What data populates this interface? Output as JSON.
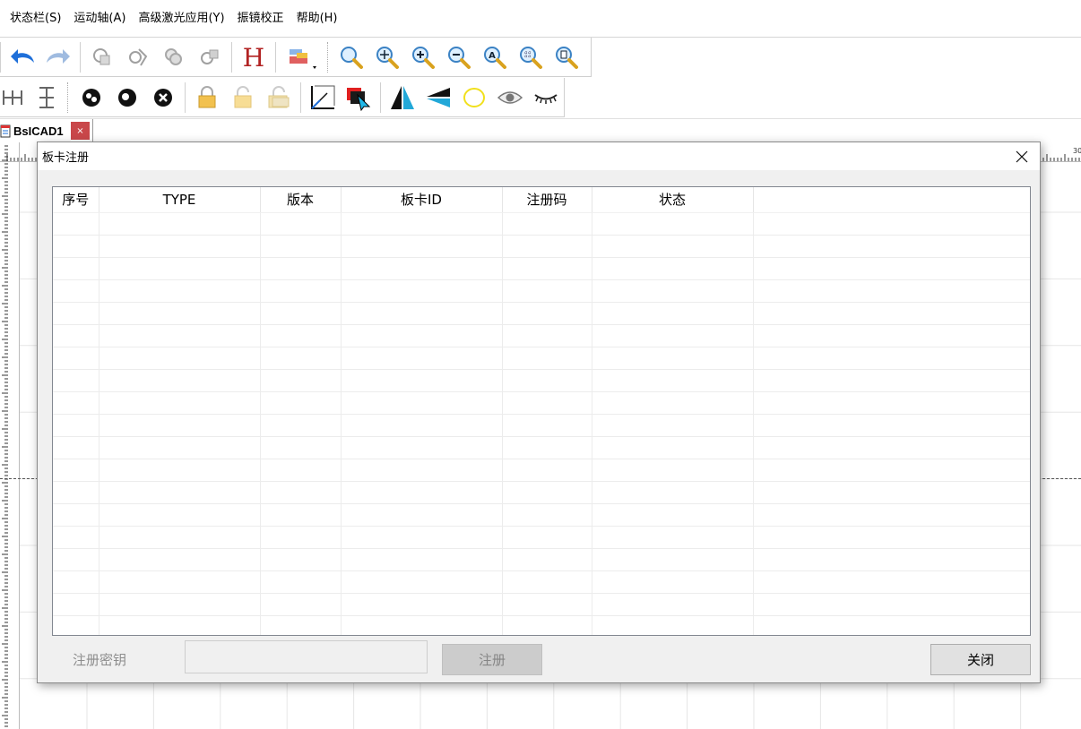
{
  "menu": [
    "状态栏(S)",
    "运动轴(A)",
    "高级激光应用(Y)",
    "振镜校正",
    "帮助(H)"
  ],
  "toolbar1": {
    "icons": [
      "undo-icon",
      "redo-icon",
      "copy-object-icon",
      "edit-object-icon",
      "duplicate-icon",
      "transform-object-icon",
      "hatch-h-icon",
      "fill-dropdown-icon",
      "zoom-icon",
      "zoom-pan-icon",
      "zoom-in-icon",
      "zoom-out-icon",
      "zoom-all-icon",
      "zoom-grid-icon",
      "zoom-page-icon"
    ]
  },
  "toolbar2": {
    "icons": [
      "distribute-horizontal-icon",
      "distribute-vertical-icon",
      "group-icon",
      "ungroup-icon",
      "delete-group-icon",
      "lock-icon",
      "unlock-icon",
      "unlock-all-icon",
      "axis-origin-icon",
      "color-layer-icon",
      "mirror-horizontal-icon",
      "mirror-vertical-icon",
      "ellipse-icon",
      "show-icon",
      "hide-icon"
    ]
  },
  "doc_tab": {
    "label": "BsICAD1",
    "close": "×"
  },
  "canvas": {
    "ruler_label": "30"
  },
  "dialog": {
    "title": "板卡注册",
    "columns": [
      "序号",
      "TYPE",
      "版本",
      "板卡ID",
      "注册码",
      "状态"
    ],
    "key_label": "注册密钥",
    "key_value": "",
    "register_label": "注册",
    "close_label": "关闭"
  },
  "colors": {
    "accent_blue": "#1e6fd9",
    "tab_close_red": "#c9474a",
    "hatch_red": "#b22222",
    "zoom_gold": "#d9a21e"
  }
}
